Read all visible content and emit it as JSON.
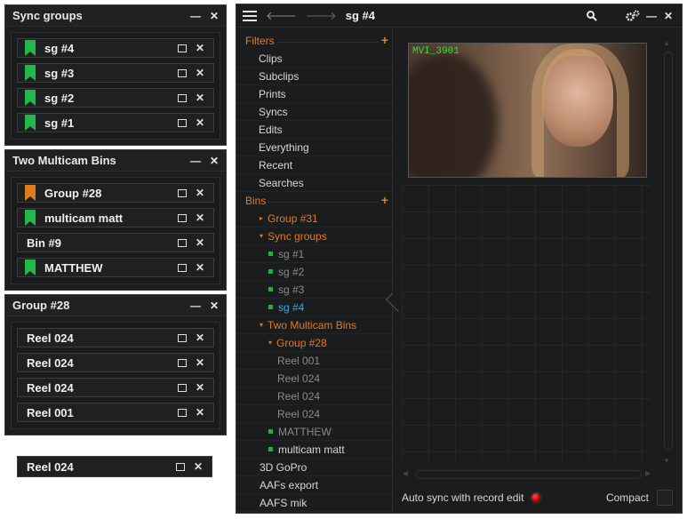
{
  "panels": {
    "sync_groups": {
      "title": "Sync groups",
      "items": [
        {
          "label": "sg #4",
          "flag": "#22b84a"
        },
        {
          "label": "sg #3",
          "flag": "#22b84a"
        },
        {
          "label": "sg #2",
          "flag": "#22b84a"
        },
        {
          "label": "sg #1",
          "flag": "#22b84a"
        }
      ]
    },
    "two_multicam": {
      "title": "Two Multicam Bins",
      "items": [
        {
          "label": "Group #28",
          "flag": "#e07a1f"
        },
        {
          "label": "multicam matt",
          "flag": "#22b84a"
        },
        {
          "label": "Bin #9",
          "flag": ""
        },
        {
          "label": "MATTHEW",
          "flag": "#22b84a"
        }
      ]
    },
    "group28": {
      "title": "Group #28",
      "items": [
        {
          "label": "Reel 024"
        },
        {
          "label": "Reel 024"
        },
        {
          "label": "Reel 024"
        },
        {
          "label": "Reel 001"
        }
      ]
    },
    "floating_item": {
      "label": "Reel 024"
    }
  },
  "controls": {
    "minimize": "—",
    "close": "✕",
    "square": "",
    "x": "✕"
  },
  "main": {
    "title": "sg #4",
    "filters": {
      "label": "Filters",
      "items": [
        "Clips",
        "Subclips",
        "Prints",
        "Syncs",
        "Edits",
        "Everything",
        "Recent",
        "Searches"
      ]
    },
    "bins": {
      "label": "Bins",
      "items": [
        {
          "label": "Group #31",
          "indent": 16,
          "style": "or",
          "prefix": "▸"
        },
        {
          "label": "Sync groups",
          "indent": 16,
          "style": "or",
          "prefix": "▾"
        },
        {
          "label": "sg #1",
          "indent": 26,
          "style": "dim",
          "prefix": "sq"
        },
        {
          "label": "sg #2",
          "indent": 26,
          "style": "dim",
          "prefix": "sq"
        },
        {
          "label": "sg #3",
          "indent": 26,
          "style": "dim",
          "prefix": "sq"
        },
        {
          "label": "sg #4",
          "indent": 26,
          "style": "blue",
          "prefix": "sq"
        },
        {
          "label": "Two Multicam Bins",
          "indent": 16,
          "style": "or",
          "prefix": "▾"
        },
        {
          "label": "Group #28",
          "indent": 26,
          "style": "or",
          "prefix": "▾"
        },
        {
          "label": "Reel 001",
          "indent": 36,
          "style": "dim",
          "prefix": ""
        },
        {
          "label": "Reel 024",
          "indent": 36,
          "style": "dim",
          "prefix": ""
        },
        {
          "label": "Reel 024",
          "indent": 36,
          "style": "dim",
          "prefix": ""
        },
        {
          "label": "Reel 024",
          "indent": 36,
          "style": "dim",
          "prefix": ""
        },
        {
          "label": "MATTHEW",
          "indent": 26,
          "style": "dim",
          "prefix": "sq"
        },
        {
          "label": "multicam matt",
          "indent": 26,
          "style": "",
          "prefix": "sq"
        },
        {
          "label": "3D GoPro",
          "indent": 16,
          "style": "",
          "prefix": ""
        },
        {
          "label": "AAFs export",
          "indent": 16,
          "style": "",
          "prefix": ""
        },
        {
          "label": "AAFS mik",
          "indent": 16,
          "style": "",
          "prefix": ""
        }
      ]
    },
    "thumbnail_label": "MVI_3901",
    "auto_sync_label": "Auto sync with record edit",
    "compact_label": "Compact"
  },
  "colors": {
    "accent": "#e07a1f",
    "green": "#22b84a",
    "blue": "#3aa8e8"
  }
}
